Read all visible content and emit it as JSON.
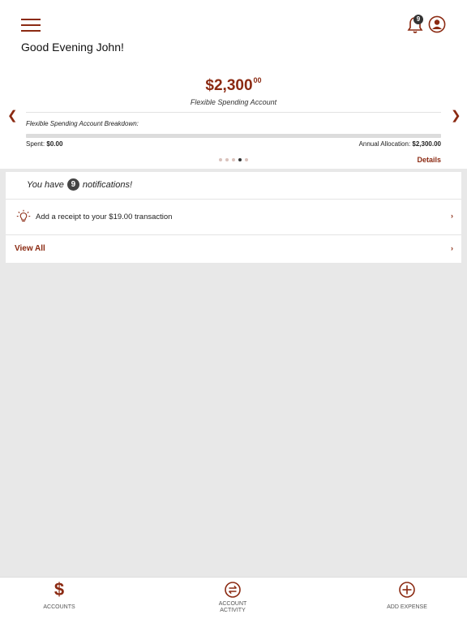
{
  "header": {
    "menu_icon": "hamburger-menu-icon",
    "bell_icon": "bell-icon",
    "bell_badge": "9",
    "profile_icon": "user-circle-icon",
    "greeting": "Good Evening John!"
  },
  "account": {
    "balance_dollars": "$2,300",
    "balance_cents": "00",
    "name": "Flexible Spending Account",
    "breakdown_label": "Flexible Spending Account Breakdown:",
    "spent_label": "Spent:",
    "spent_value": "$0.00",
    "annual_label": "Annual Allocation:",
    "annual_value": "$2,300.00",
    "progress_fraction": 0,
    "details_label": "Details",
    "carousel_prev_icon": "chevron-left-icon",
    "carousel_next_icon": "chevron-right-icon",
    "pages": 5,
    "active_page": 4
  },
  "notifications": {
    "prefix": "You have",
    "count": "9",
    "suffix": "notifications!",
    "items": [
      {
        "icon": "lightbulb-icon",
        "text": "Add a receipt to your $19.00 transaction"
      }
    ],
    "view_all_label": "View All",
    "chevron": "›"
  },
  "tabbar": {
    "accounts_label": "ACCOUNTS",
    "accounts_icon": "dollar-icon",
    "activity_line1": "ACCOUNT",
    "activity_line2": "ACTIVITY",
    "activity_icon": "exchange-arrows-icon",
    "add_expense_label": "ADD EXPENSE",
    "add_expense_icon": "plus-circle-icon"
  },
  "colors": {
    "accent": "#8b2a12",
    "background": "#e8e8e8",
    "surface": "#ffffff"
  }
}
